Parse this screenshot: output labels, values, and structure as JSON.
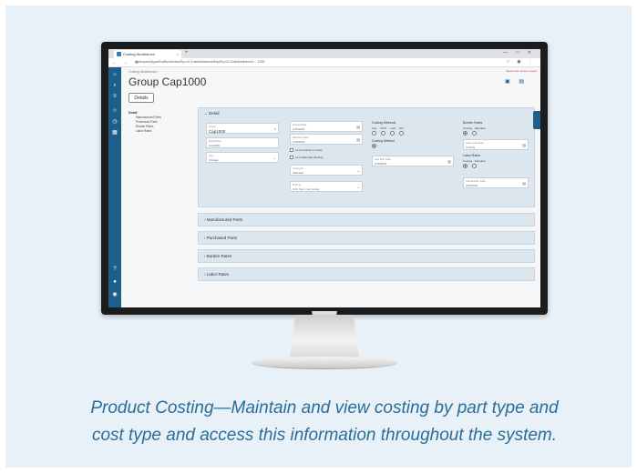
{
  "browser": {
    "tab_title": "Costing Workbench",
    "tab_close": "×",
    "new_tab": "+",
    "window_controls": "— □ ✕",
    "nav_buttons": "← → ⟳",
    "url": "epicorpurl/Apps/ErpRun/#/view/Erp.UI.CostWorkbench/Erp/Erp.UI.CostWorkbench?... 1000",
    "url_right": "☆ ◉ ⋮"
  },
  "app": {
    "breadcrumb": "Costing Workbench  /",
    "title": "Group Cap1000",
    "top_links": "Epicor Dev    Home    Logout",
    "details_button": "Details",
    "tree": {
      "root": "Detail",
      "items": [
        "Manufactured Parts",
        "Purchased Parts",
        "Burden Rates",
        "Labor Rates"
      ]
    },
    "detail_panel": {
      "heading": "Detail",
      "group_label": "Group",
      "group_value": "Cap1000",
      "description_label": "Description",
      "description_value": "Cap1000",
      "site_label": "Site",
      "site_value": "Chicago",
      "posted_label": "Posted Date",
      "posted_value": "2/15/2023",
      "eff_label": "Effective Date",
      "eff_value": "2/15/2023",
      "check_1": "Limit Costing to Group",
      "check_2": "Limit Materials (Rollup)",
      "cost_type_label": "Cost type",
      "cost_type_value": "Standard",
      "rollup_label": "Roll Up",
      "rollup_value": "Only from Cost Group",
      "costing_methods": "Costing Methods",
      "method_options": [
        "Avg",
        "FIFO",
        "Last",
        "Std"
      ],
      "costing_method_label": "Costing Method",
      "last_run_label": "Last Run Date",
      "last_run_value": "2/15/2023",
      "burden_rates": "Burden Rates",
      "burden_options": [
        "Costing",
        "Standard"
      ],
      "labor_rates": "Labor Rates",
      "labor_options": [
        "Costing",
        "Standard"
      ],
      "labor_date_label": "Labor Last Rate",
      "labor_date_value": "Costing",
      "burden_date_label": "Last Burden Rate",
      "burden_date_value": "2/15/2023"
    },
    "sections": [
      "Manufactured Parts",
      "Purchased Parts",
      "Burden Rates",
      "Labor Rates"
    ]
  },
  "caption": {
    "line1": "Product Costing—Maintain and view costing by part type and",
    "line2": "cost type and access this information throughout the system."
  }
}
